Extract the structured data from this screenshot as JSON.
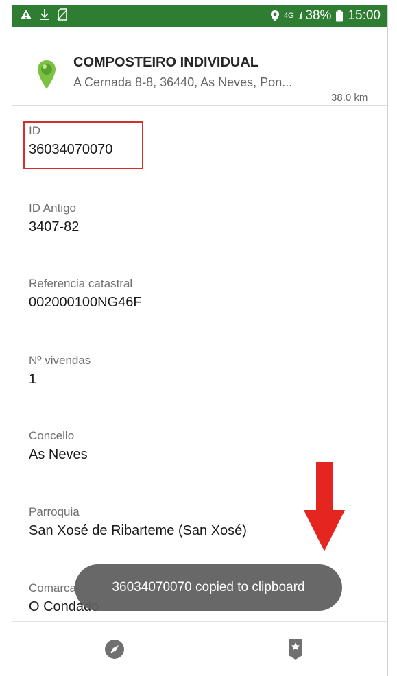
{
  "status_bar": {
    "left_icons": [
      "warning-icon",
      "download-icon",
      "no-sim-icon"
    ],
    "network": "4G",
    "battery": "38%",
    "time": "15:00"
  },
  "header": {
    "title": "COMPOSTEIRO INDIVIDUAL",
    "address": "A Cernada 8-8, 36440, As Neves, Pon...",
    "distance": "38.0 km",
    "pin_color": "#7cc142"
  },
  "fields": [
    {
      "label": "ID",
      "value": "36034070070"
    },
    {
      "label": "ID Antigo",
      "value": "3407-82"
    },
    {
      "label": "Referencia catastral",
      "value": "002000100NG46F"
    },
    {
      "label": "Nº vivendas",
      "value": "1"
    },
    {
      "label": "Concello",
      "value": "As Neves"
    },
    {
      "label": "Parroquia",
      "value": "San Xosé de Ribarteme (San Xosé)"
    },
    {
      "label": "Comarca",
      "value": "O Condado"
    }
  ],
  "toast": {
    "message": "36034070070 copied to clipboard"
  },
  "bottom_nav": {
    "items": [
      "compass-icon",
      "bookmark-star-icon"
    ]
  },
  "colors": {
    "status_bar": "#2e7d32",
    "highlight": "#d32f2f",
    "arrow": "#e52620"
  }
}
